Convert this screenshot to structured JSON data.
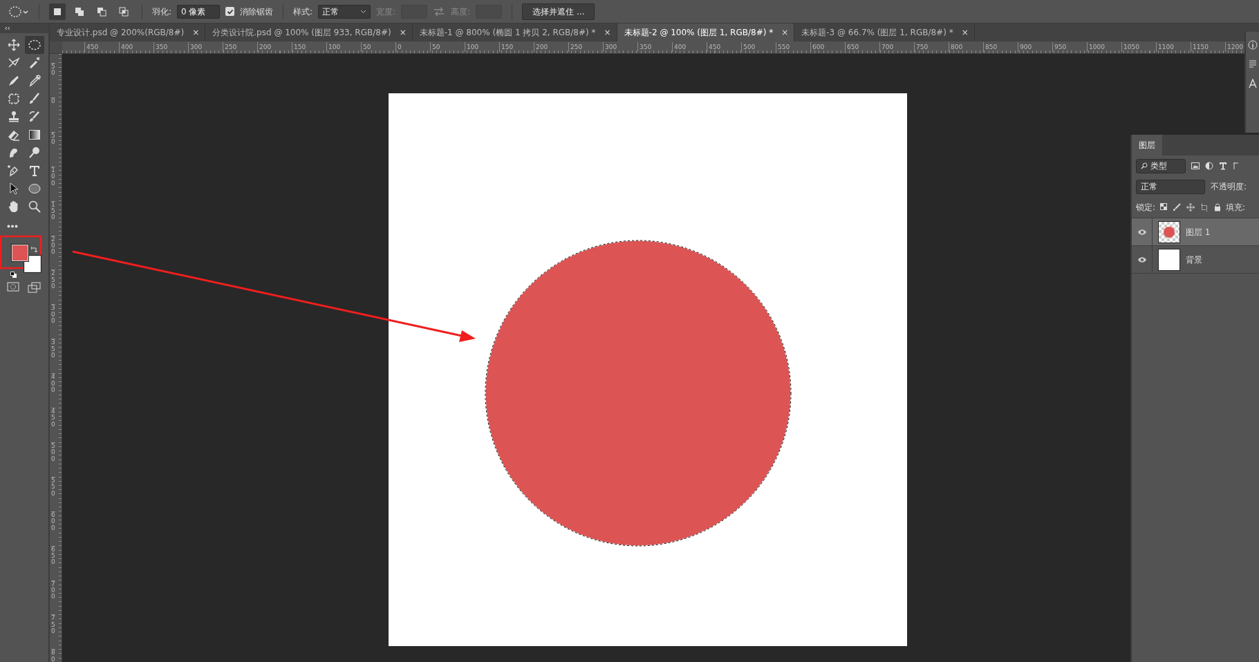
{
  "options_bar": {
    "feather_label": "羽化:",
    "feather_value": "0 像素",
    "antialias": {
      "label": "消除锯齿",
      "checked": true
    },
    "style_label": "样式:",
    "style_value": "正常",
    "width_label": "宽度:",
    "height_label": "高度:",
    "mask_button": "选择并遮住 ...",
    "modes": [
      {
        "kind": "new",
        "selected": true
      },
      {
        "kind": "add",
        "selected": false
      },
      {
        "kind": "subtract",
        "selected": false
      },
      {
        "kind": "intersect",
        "selected": false
      }
    ]
  },
  "tabs": [
    {
      "label": "专业设计.psd @ 200%(RGB/8#)",
      "selected": false,
      "close": "×"
    },
    {
      "label": "分类设计院.psd @ 100% (图层 933, RGB/8#)",
      "selected": false,
      "close": "×"
    },
    {
      "label": "未标题-1 @ 800% (椭圆 1 拷贝 2, RGB/8#) *",
      "selected": false,
      "close": "×"
    },
    {
      "label": "未标题-2 @ 100% (图层 1, RGB/8#) *",
      "selected": true,
      "close": "×"
    },
    {
      "label": "未标题-3 @ 66.7% (图层 1, RGB/8#) *",
      "selected": false,
      "close": "×"
    }
  ],
  "rulers": {
    "horizontal": [
      "450",
      "400",
      "350",
      "300",
      "250",
      "200",
      "150",
      "100",
      "50",
      "0",
      "50",
      "100",
      "150",
      "200",
      "250",
      "300",
      "350",
      "400",
      "450",
      "500",
      "550",
      "600",
      "650",
      "700",
      "750",
      "800",
      "850",
      "900",
      "950",
      "1000",
      "1050",
      "1100",
      "1150",
      "1200"
    ],
    "vertical": [
      "50",
      "0",
      "50",
      "100",
      "150",
      "200",
      "250",
      "300",
      "350",
      "400",
      "450",
      "500",
      "550",
      "600",
      "650",
      "700",
      "750",
      "800"
    ]
  },
  "toolbox": {
    "tools": [
      {
        "kind": "move",
        "selected": false
      },
      {
        "kind": "ellipse-marquee",
        "selected": true
      },
      {
        "kind": "lasso",
        "selected": false
      },
      {
        "kind": "magic-wand",
        "selected": false
      },
      {
        "kind": "pencil",
        "selected": false
      },
      {
        "kind": "eyedropper",
        "selected": false
      },
      {
        "kind": "crop-frame",
        "selected": false
      },
      {
        "kind": "brush",
        "selected": false
      },
      {
        "kind": "stamp",
        "selected": false
      },
      {
        "kind": "history-brush",
        "selected": false
      },
      {
        "kind": "eraser",
        "selected": false
      },
      {
        "kind": "gradient",
        "selected": false
      },
      {
        "kind": "smudge",
        "selected": false
      },
      {
        "kind": "dodge",
        "selected": false
      },
      {
        "kind": "pen",
        "selected": false
      },
      {
        "kind": "type",
        "selected": false
      },
      {
        "kind": "cursor-arrow",
        "selected": false
      },
      {
        "kind": "ellipse",
        "selected": false
      },
      {
        "kind": "hand",
        "selected": false
      },
      {
        "kind": "zoom",
        "selected": false
      }
    ],
    "swatches": [
      {
        "kind": "foreground",
        "color": "#dc5454"
      },
      {
        "kind": "background",
        "color": "#ffffff"
      }
    ]
  },
  "canvas": {
    "shape": {
      "kind": "circle",
      "color": "#dc5454",
      "marquee": true
    }
  },
  "layers_panel": {
    "tab": "图层",
    "filter": "类型",
    "blend_mode": "正常",
    "opacity_label": "不透明度:",
    "lock_label": "锁定:",
    "fill_label": "填充:",
    "layers": [
      {
        "name": "图层 1",
        "kind": "pixel",
        "visible": true,
        "selected": true
      },
      {
        "name": "背景",
        "kind": "background",
        "visible": true,
        "selected": false
      }
    ]
  }
}
